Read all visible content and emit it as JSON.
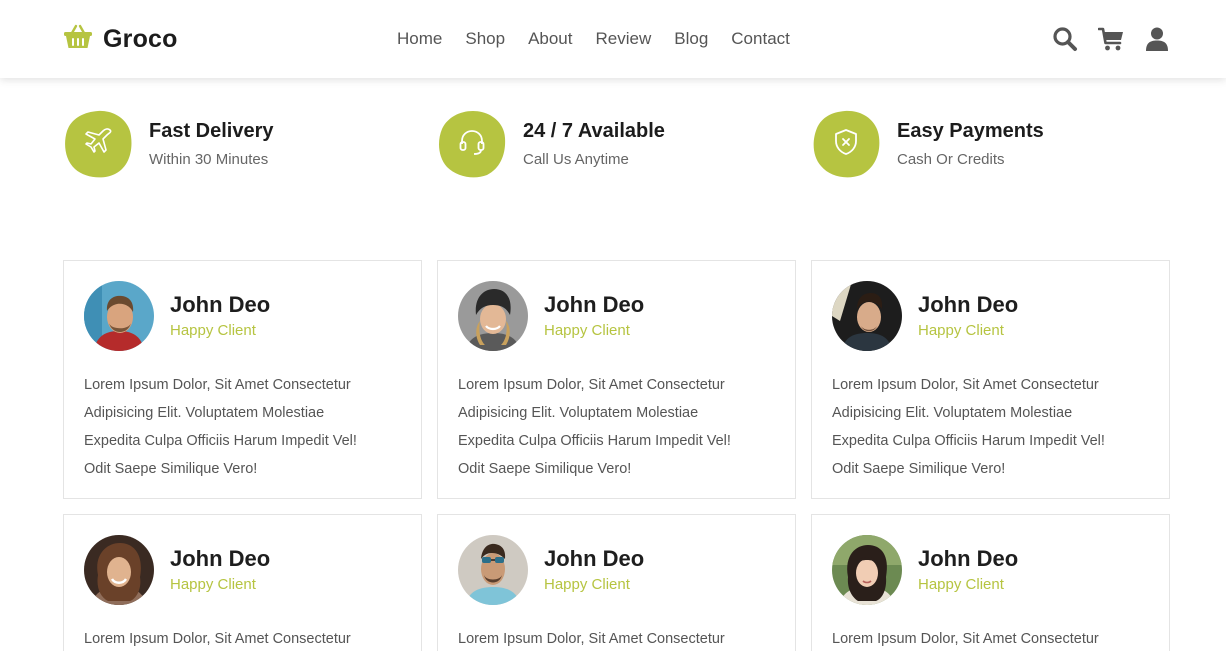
{
  "brand": {
    "name": "Groco",
    "icon": "basket-icon",
    "accent": "#b6c441"
  },
  "nav": {
    "items": [
      "Home",
      "Shop",
      "About",
      "Review",
      "Blog",
      "Contact"
    ]
  },
  "header_icons": [
    "search-icon",
    "cart-icon",
    "user-icon"
  ],
  "features": [
    {
      "title": "Fast Delivery",
      "subtitle": "Within 30 Minutes",
      "icon": "plane-icon"
    },
    {
      "title": "24 / 7 Available",
      "subtitle": "Call Us Anytime",
      "icon": "headset-icon"
    },
    {
      "title": "Easy Payments",
      "subtitle": "Cash Or Credits",
      "icon": "shield-icon"
    }
  ],
  "reviews": [
    {
      "name": "John Deo",
      "role": "Happy Client",
      "lines": [
        "Lorem Ipsum Dolor, Sit Amet Consectetur",
        "Adipisicing Elit. Voluptatem Molestiae",
        "Expedita Culpa Officiis Harum Impedit Vel!",
        "Odit Saepe Similique Vero!"
      ]
    },
    {
      "name": "John Deo",
      "role": "Happy Client",
      "lines": [
        "Lorem Ipsum Dolor, Sit Amet Consectetur",
        "Adipisicing Elit. Voluptatem Molestiae",
        "Expedita Culpa Officiis Harum Impedit Vel!",
        "Odit Saepe Similique Vero!"
      ]
    },
    {
      "name": "John Deo",
      "role": "Happy Client",
      "lines": [
        "Lorem Ipsum Dolor, Sit Amet Consectetur",
        "Adipisicing Elit. Voluptatem Molestiae",
        "Expedita Culpa Officiis Harum Impedit Vel!",
        "Odit Saepe Similique Vero!"
      ]
    },
    {
      "name": "John Deo",
      "role": "Happy Client",
      "lines": [
        "Lorem Ipsum Dolor, Sit Amet Consectetur"
      ]
    },
    {
      "name": "John Deo",
      "role": "Happy Client",
      "lines": [
        "Lorem Ipsum Dolor, Sit Amet Consectetur"
      ]
    },
    {
      "name": "John Deo",
      "role": "Happy Client",
      "lines": [
        "Lorem Ipsum Dolor, Sit Amet Consectetur"
      ]
    }
  ]
}
